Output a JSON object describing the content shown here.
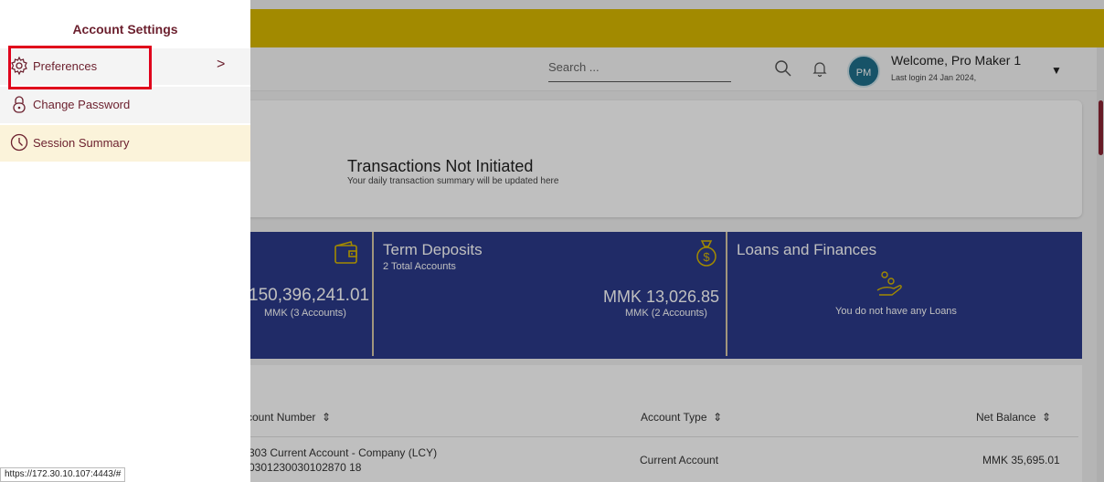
{
  "header": {
    "search_placeholder": "Search ...",
    "avatar_initials": "PM",
    "welcome": "Welcome, Pro Maker 1",
    "last_login": "Last login 24 Jan 2024,"
  },
  "summary": {
    "title": "Transactions Not Initiated",
    "subtitle": "Your daily transaction summary will be updated here"
  },
  "tiles": {
    "casa": {
      "amount": "150,396,241.01",
      "sub": "MMK (3 Accounts)"
    },
    "term": {
      "title": "Term Deposits",
      "count": "2 Total Accounts",
      "amount": "MMK 13,026.85",
      "sub": "MMK (2 Accounts)"
    },
    "loans": {
      "title": "Loans and Finances",
      "empty": "You do not have any Loans"
    }
  },
  "table": {
    "columns": [
      "count Number",
      "Account Type",
      "Net Balance"
    ],
    "rows": [
      {
        "name": "303 Current Account - Company (LCY)",
        "number": "0301230030102870 18",
        "type": "Current Account",
        "balance": "MMK 35,695.01"
      }
    ]
  },
  "drawer": {
    "title": "Account Settings",
    "items": [
      {
        "label": "Preferences"
      },
      {
        "label": "Change Password"
      },
      {
        "label": "Session Summary"
      }
    ]
  },
  "status_url": "https://172.30.10.107:4443/#",
  "colors": {
    "brand": "#6b1f2d",
    "topband": "#d9b800",
    "tiles": "#2b3a8a",
    "highlight": "#e0001b"
  }
}
